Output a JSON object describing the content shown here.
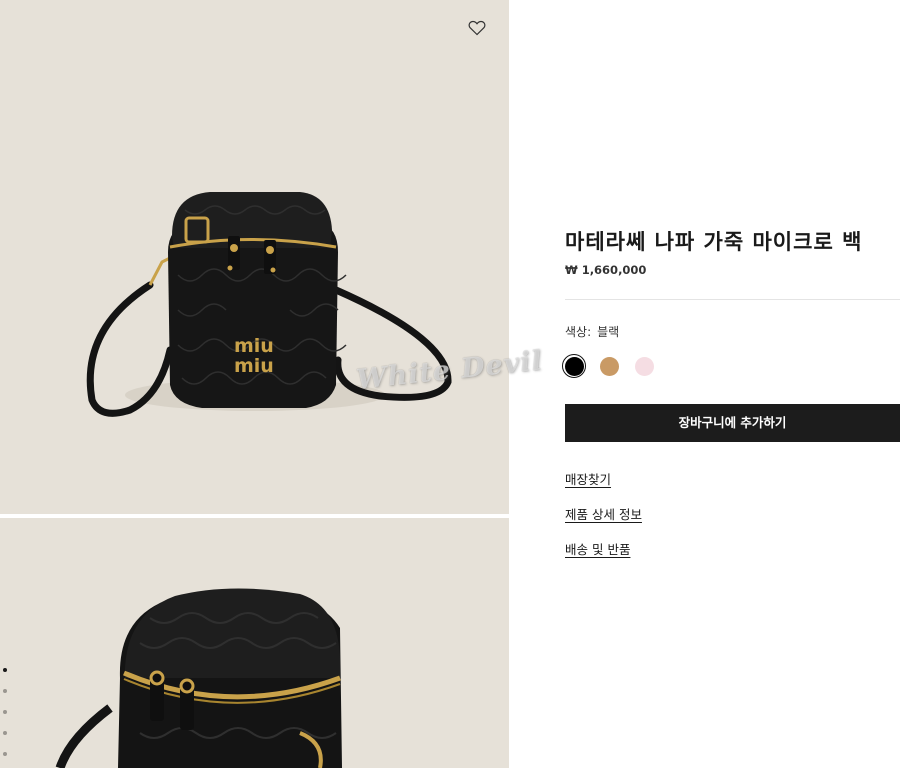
{
  "product": {
    "title": "마테라쎄 나파 가죽 마이크로 백",
    "price": "₩ 1,660,000",
    "brand_mark": "miu miu",
    "color_label": "색상:",
    "color_value": "블랙",
    "swatches": [
      {
        "name": "black",
        "color": "#000000",
        "selected": true
      },
      {
        "name": "tan",
        "color": "#c99a65",
        "selected": false
      },
      {
        "name": "pink",
        "color": "#f5dde3",
        "selected": false
      }
    ]
  },
  "actions": {
    "add_to_cart": "장바구니에 추가하기",
    "find_store": "매장찾기",
    "product_details": "제품 상세 정보",
    "shipping_returns": "배송 및 반품"
  },
  "gallery": {
    "watermark": "White Devil",
    "dots_count": 5,
    "active_dot": 0
  },
  "colors": {
    "photo_bg": "#e6e1d8",
    "button_bg": "#1c1c1c",
    "bag": "#161616",
    "hardware": "#c9a24a"
  },
  "icons": {
    "wishlist": "heart-outline-icon"
  }
}
